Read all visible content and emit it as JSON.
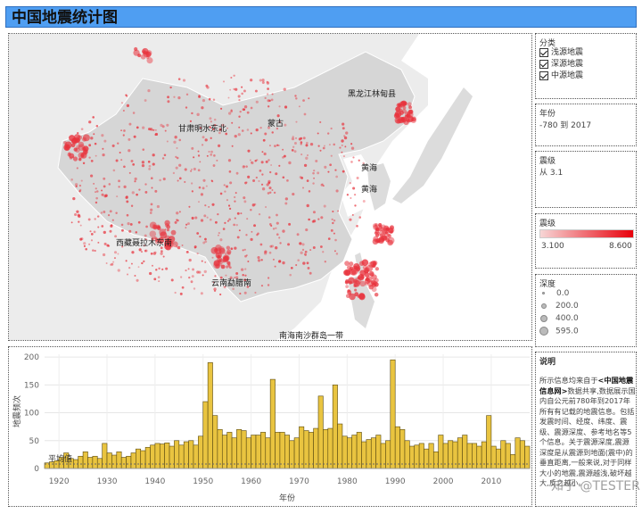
{
  "header": {
    "title": "中国地震统计图"
  },
  "map": {
    "labels": [
      "黑龙江林甸县",
      "蒙古",
      "甘肃明水东北",
      "黄海",
      "黄海",
      "西藏聂拉木东南",
      "云南勐腊南",
      "南海南沙群岛一带"
    ]
  },
  "filters": {
    "category": {
      "title": "分类",
      "items": [
        "浅源地震",
        "深源地震",
        "中源地震"
      ]
    },
    "year": {
      "title": "年份",
      "value": "-780 到 2017"
    },
    "magnitude_filter": {
      "title": "震级",
      "value": "从 3.1"
    },
    "magnitude_legend": {
      "title": "震级",
      "min": "3.100",
      "max": "8.600",
      "color_min": "#f7d6d6",
      "color_max": "#e8000b"
    },
    "depth_legend": {
      "title": "深度",
      "values": [
        "0.0",
        "200.0",
        "400.0",
        "595.0"
      ]
    }
  },
  "notes": {
    "title": "说明",
    "text_1": "所示信息均来自于",
    "text_bold": "<中国地震信息网>",
    "text_2": "数据共享,数据展示国内自公元前780年到2017年所有有记载的地震信息。包括发震时间、经度、纬度、震级、震源深度、参考地名等5个信息。关于震源深度,震源深度是从震源到地面(震中)的垂直距离,一般来说,对于同样大小的地震,震源越浅,破坏越大,反之越小。"
  },
  "watermark": "知乎 @TESTER",
  "chart_data": {
    "type": "bar",
    "title": "",
    "xlabel": "年份",
    "ylabel": "地震频次",
    "x_start": 1917,
    "x_end": 2017,
    "xticks": [
      1920,
      1930,
      1940,
      1950,
      1960,
      1970,
      1980,
      1990,
      2000,
      2010
    ],
    "yticks": [
      0,
      50,
      100,
      150,
      200
    ],
    "ylim": [
      0,
      205
    ],
    "bar_color": "#e9c440",
    "average_label": "平均值",
    "average_value": 8,
    "values": [
      10,
      12,
      14,
      20,
      28,
      18,
      16,
      22,
      30,
      20,
      22,
      18,
      45,
      28,
      24,
      30,
      20,
      22,
      28,
      35,
      32,
      38,
      42,
      45,
      44,
      46,
      40,
      50,
      42,
      48,
      50,
      42,
      58,
      120,
      190,
      95,
      70,
      60,
      65,
      55,
      70,
      68,
      55,
      60,
      60,
      65,
      55,
      160,
      65,
      65,
      60,
      50,
      55,
      75,
      68,
      65,
      72,
      130,
      70,
      72,
      150,
      80,
      58,
      55,
      60,
      65,
      48,
      52,
      55,
      60,
      45,
      50,
      195,
      75,
      70,
      50,
      40,
      42,
      45,
      35,
      45,
      30,
      60,
      45,
      50,
      48,
      55,
      60,
      45,
      45,
      40,
      48,
      95,
      40,
      35,
      50,
      45,
      25,
      55,
      50,
      40
    ]
  }
}
